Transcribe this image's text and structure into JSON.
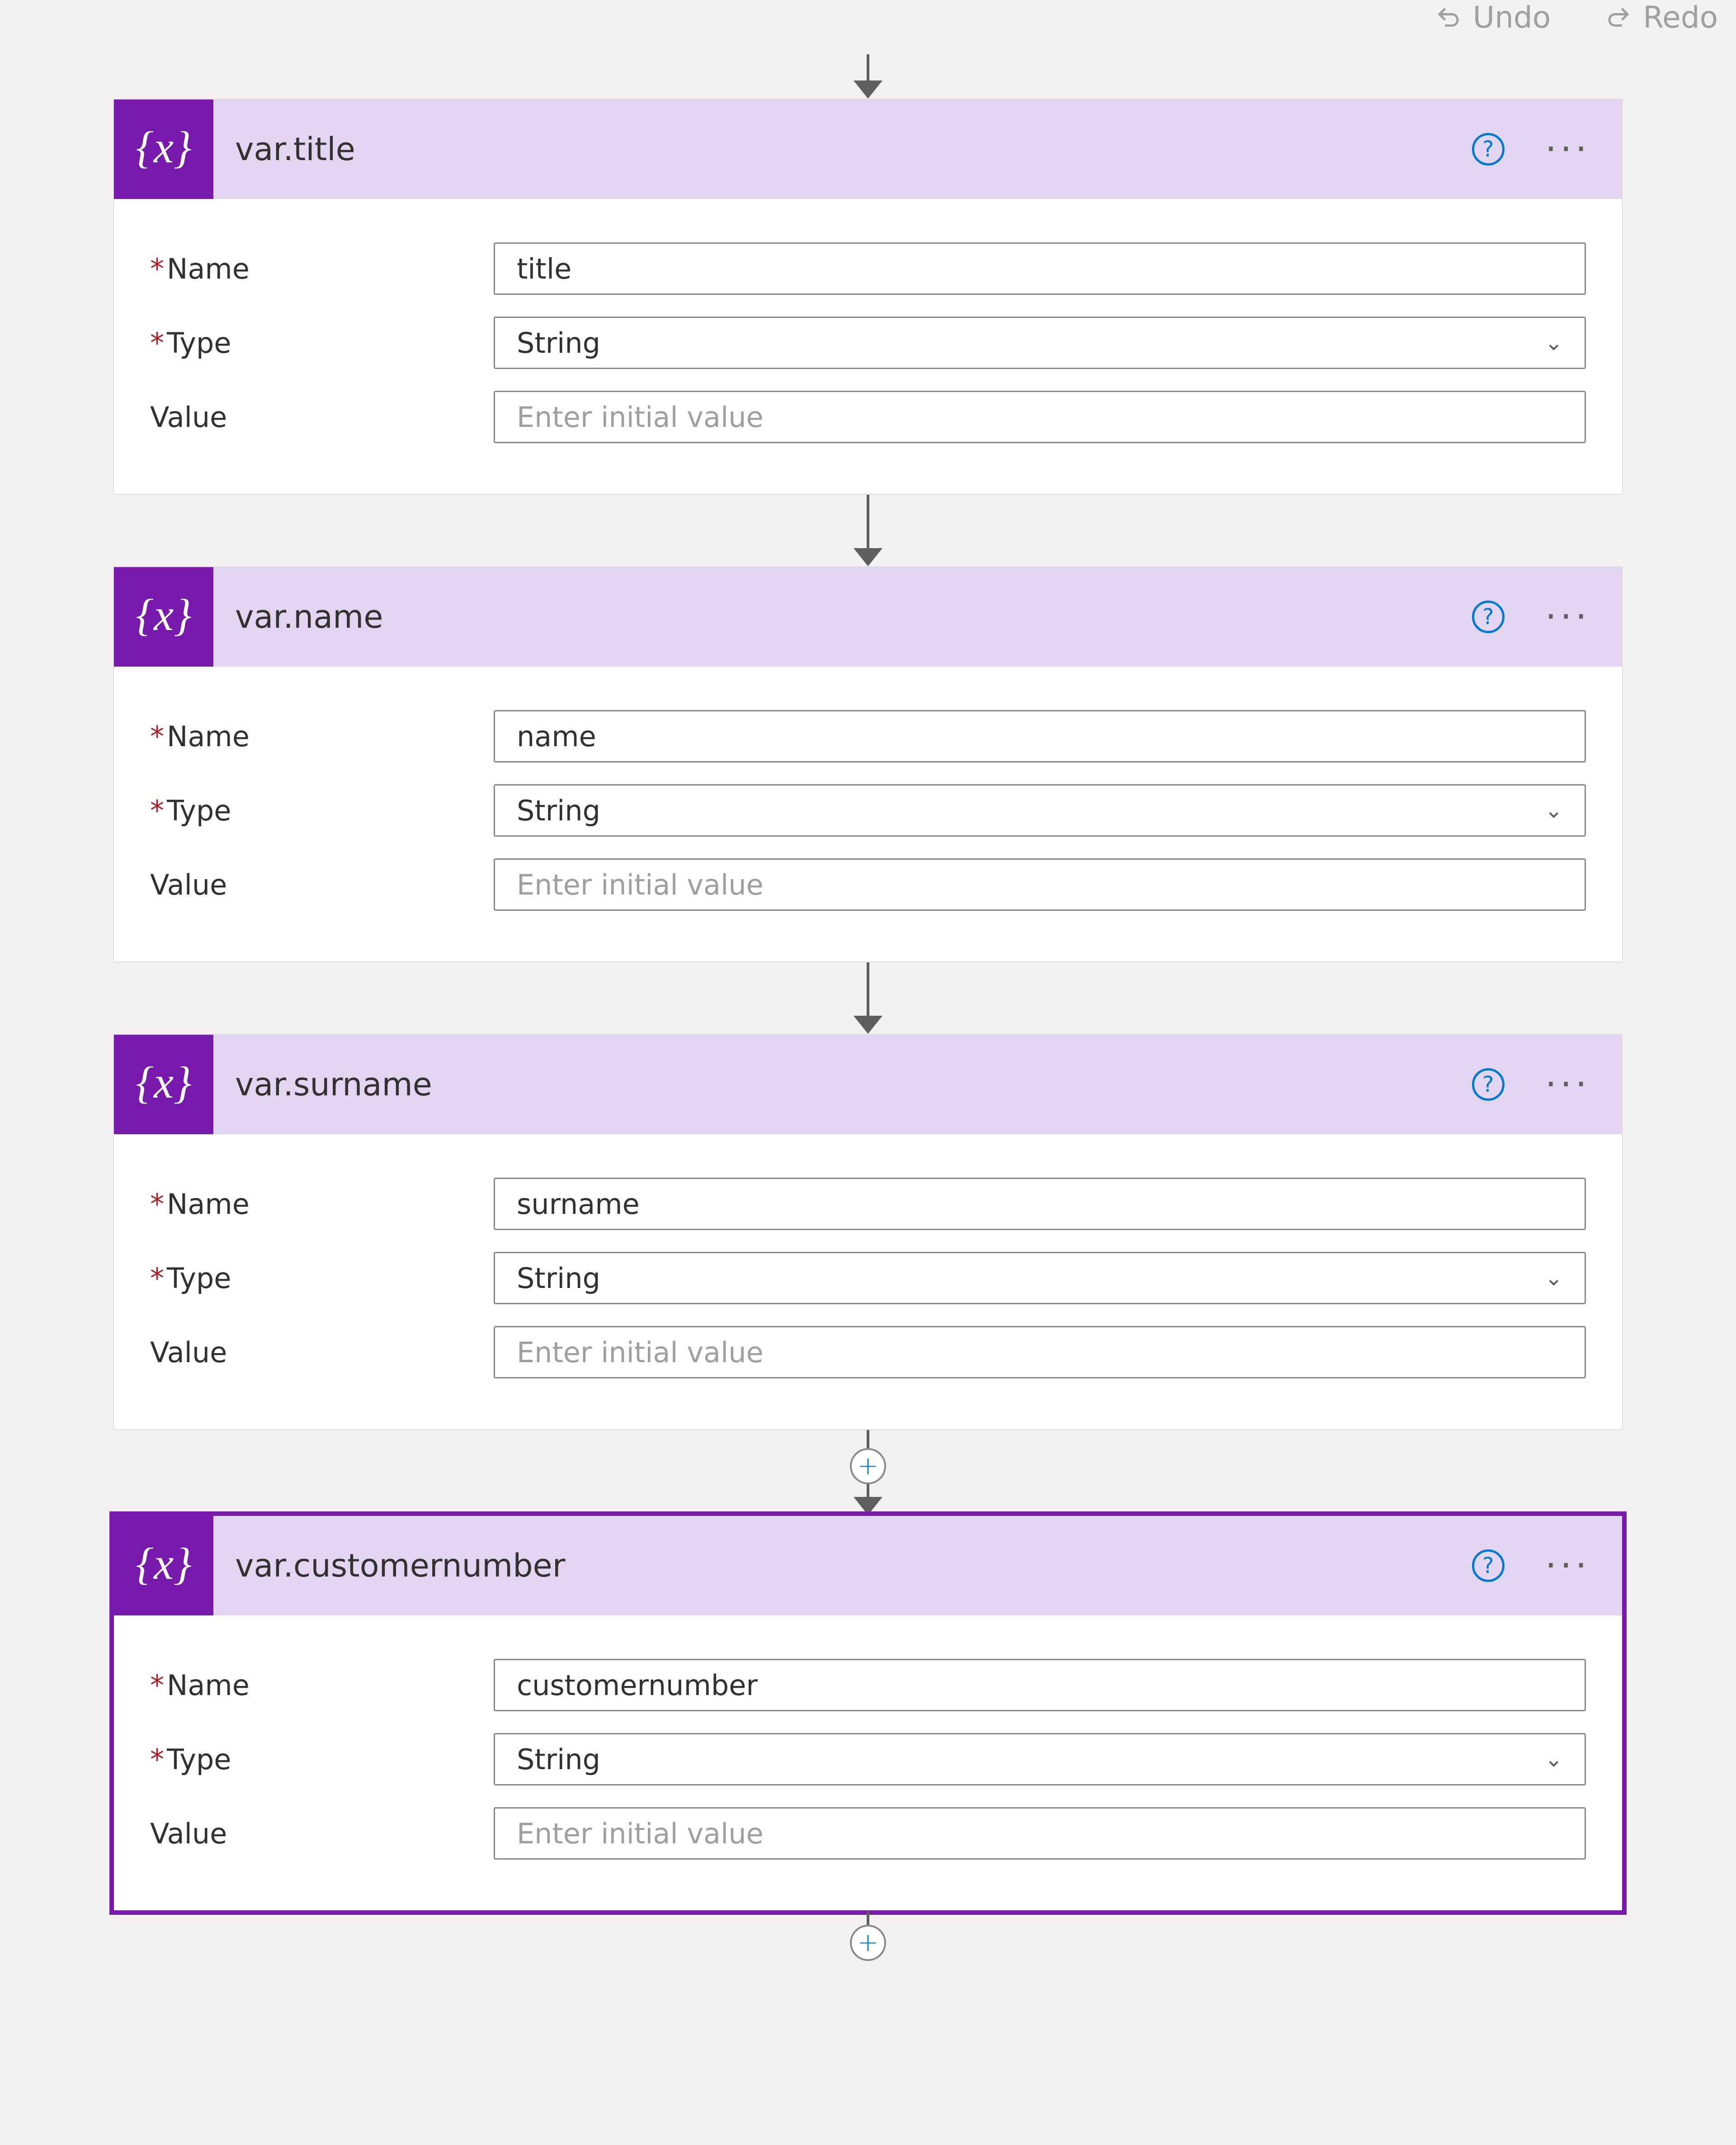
{
  "toolbar": {
    "undo": "Undo",
    "redo": "Redo"
  },
  "labels": {
    "name": "Name",
    "type": "Type",
    "value": "Value",
    "value_placeholder": "Enter initial value"
  },
  "steps": [
    {
      "title": "var.title",
      "name_value": "title",
      "type_value": "String",
      "value_value": "",
      "selected": false
    },
    {
      "title": "var.name",
      "name_value": "name",
      "type_value": "String",
      "value_value": "",
      "selected": false
    },
    {
      "title": "var.surname",
      "name_value": "surname",
      "type_value": "String",
      "value_value": "",
      "selected": false
    },
    {
      "title": "var.customernumber",
      "name_value": "customernumber",
      "type_value": "String",
      "value_value": "",
      "selected": true
    }
  ],
  "insert_button_index": 3,
  "icons": {
    "variable": "variable-icon"
  }
}
